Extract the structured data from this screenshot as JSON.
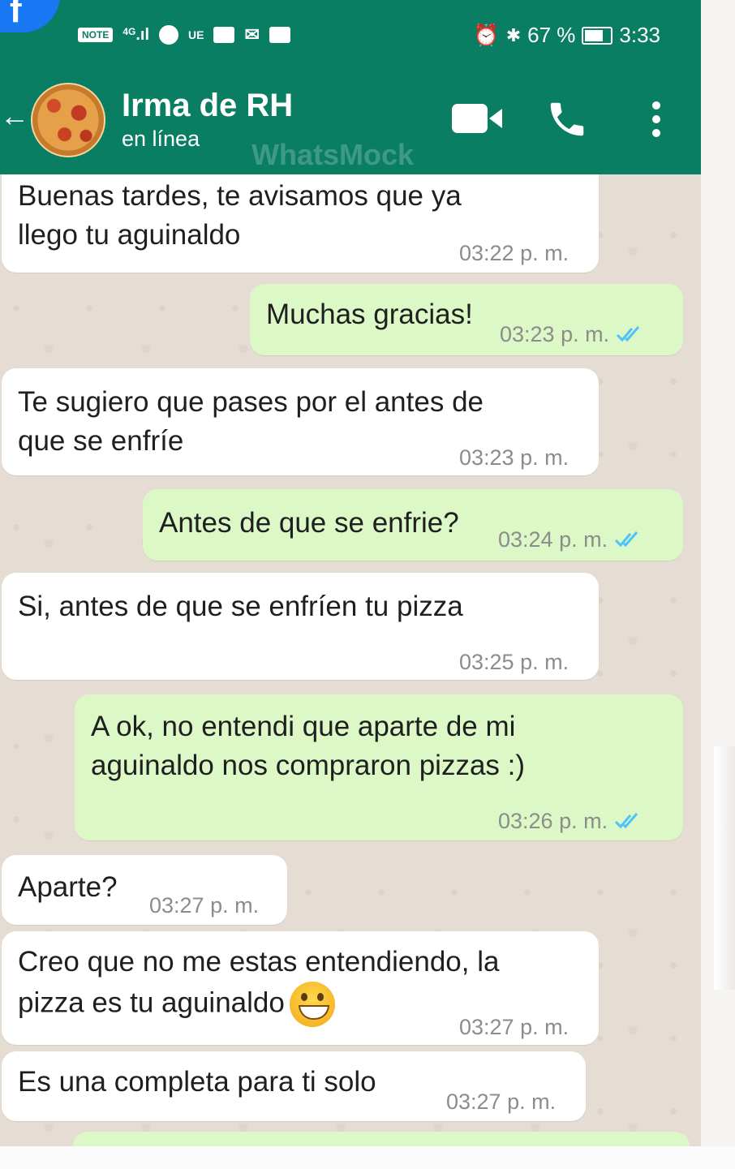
{
  "status_bar": {
    "left_icons": [
      "carrier-chip",
      "signal-icon",
      "spotify-icon",
      "app-icon",
      "youtube-icon",
      "gmail-icon",
      "video-icon"
    ],
    "carrier_chip": "NOTE",
    "network": "4G",
    "ue_label": "UE",
    "battery": "67 %",
    "time": "3:33"
  },
  "header": {
    "contact_name": "Irma de RH",
    "contact_status": "en línea",
    "watermark": "WhatsMock"
  },
  "messages": [
    {
      "dir": "in",
      "lines": [
        "Buenas tardes, te avisamos que ya",
        "llego tu aguinaldo"
      ],
      "time": "03:22 p. m."
    },
    {
      "dir": "out",
      "lines": [
        "Muchas gracias!"
      ],
      "time": "03:23 p. m.",
      "read": true
    },
    {
      "dir": "in",
      "lines": [
        "Te sugiero que pases por el antes de",
        "que se enfríe"
      ],
      "time": "03:23 p. m."
    },
    {
      "dir": "out",
      "lines": [
        "Antes de que se enfrie?"
      ],
      "time": "03:24 p. m.",
      "read": true
    },
    {
      "dir": "in",
      "lines": [
        "Si, antes de que se enfríen tu pizza"
      ],
      "time": "03:25 p. m."
    },
    {
      "dir": "out",
      "lines": [
        "A ok, no entendi que aparte de mi",
        "aguinaldo nos compraron pizzas :)"
      ],
      "time": "03:26 p. m.",
      "read": true
    },
    {
      "dir": "in",
      "lines": [
        "Aparte?"
      ],
      "time": "03:27 p. m."
    },
    {
      "dir": "in",
      "lines": [
        "Creo que no me estas entendiendo, la",
        "pizza es tu aguinaldo"
      ],
      "time": "03:27 p. m.",
      "emoji": "grinning-face"
    },
    {
      "dir": "in",
      "lines": [
        "Es una completa para ti solo"
      ],
      "time": "03:27 p. m."
    }
  ],
  "colors": {
    "header": "#0a7e62",
    "incoming_bubble": "#ffffff",
    "outgoing_bubble": "#dcf8c6",
    "read_ticks": "#4fc3f7",
    "chat_background": "#e5ddd4"
  }
}
